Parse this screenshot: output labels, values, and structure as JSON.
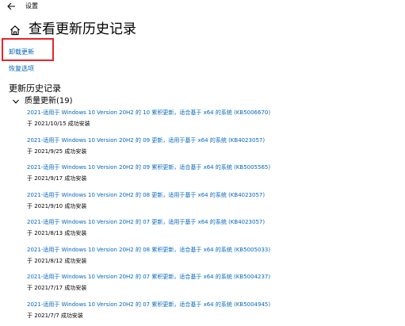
{
  "app": {
    "title": "设置"
  },
  "page": {
    "title": "查看更新历史记录"
  },
  "links": {
    "uninstall": "卸载更新",
    "recovery": "恢复选项"
  },
  "history": {
    "header": "更新历史记录",
    "group_label": "质量更新(19)",
    "items": [
      {
        "title": "2021-适用于 Windows 10 Version 20H2 的 10 累积更新，适合基于 x64 的系统 (KB5006670)",
        "status": "于 2021/10/15 成功安装"
      },
      {
        "title": "2021-适用于 Windows 10 Version 20H2 的 09 更新，适用于基于 x64 的系统 (KB4023057)",
        "status": "于 2021/9/25 成功安装"
      },
      {
        "title": "2021-适用于 Windows 10 Version 20H2 的 09 累积更新，适合基于 x64 的系统 (KB5005565)",
        "status": "于 2021/9/17 成功安装"
      },
      {
        "title": "2021-适用于 Windows 10 Version 20H2 的 08 更新，适用于基于 x64 的系统 (KB4023057)",
        "status": "于 2021/9/10 成功安装"
      },
      {
        "title": "2021-适用于 Windows 10 Version 20H2 的 07 更新，适用于基于 x64 的系统 (KB4023057)",
        "status": "于 2021/8/13 成功安装"
      },
      {
        "title": "2021-适用于 Windows 10 Version 20H2 的 08 累积更新，适合基于 x64 的系统 (KB5005033)",
        "status": "于 2021/8/12 成功安装"
      },
      {
        "title": "2021-适用于 Windows 10 Version 20H2 的 07 累积更新，适合基于 x64 的系统 (KB5004237)",
        "status": "于 2021/7/17 成功安装"
      },
      {
        "title": "2021-适用于 Windows 10 Version 20H2 的 07 累积更新，适合基于 x64 的系统 (KB5004945)",
        "status": "于 2021/7/7 成功安装"
      }
    ]
  },
  "icons": {
    "back": "back-arrow-icon",
    "home": "home-icon",
    "expand": "chevron-down-icon"
  },
  "colors": {
    "link": "#0067c0",
    "highlight_box": "#e8232a",
    "text": "#000000",
    "background": "#ffffff"
  }
}
